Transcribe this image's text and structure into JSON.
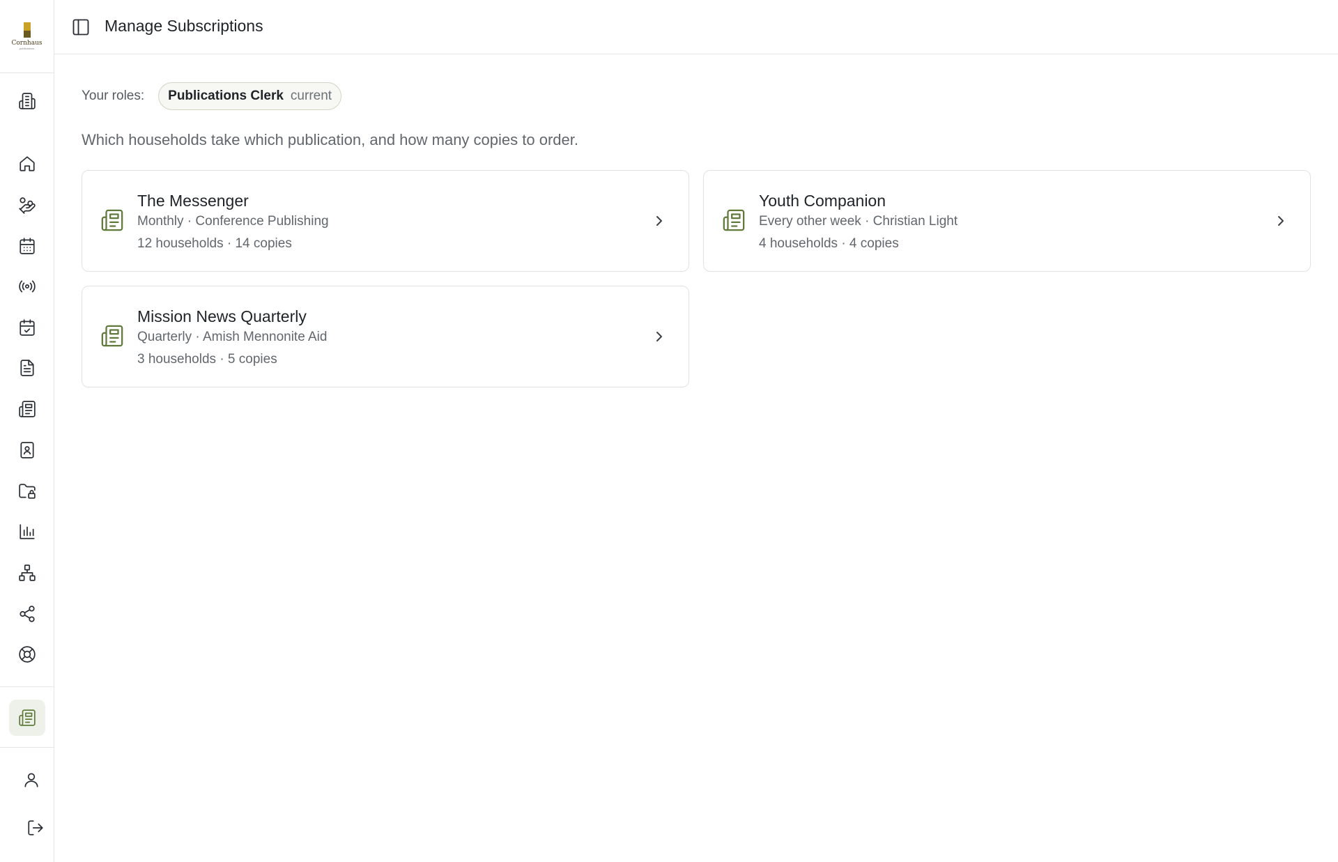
{
  "app": {
    "logo_text": "Cornhaus",
    "logo_subtext": "publications"
  },
  "header": {
    "title": "Manage Subscriptions"
  },
  "sidebar": {
    "items": [
      {
        "icon": "building-icon"
      },
      {
        "icon": "home-icon"
      },
      {
        "icon": "hand-coins-icon"
      },
      {
        "icon": "calendar-icon"
      },
      {
        "icon": "broadcast-icon"
      },
      {
        "icon": "calendar-check-icon"
      },
      {
        "icon": "document-icon"
      },
      {
        "icon": "newspaper-icon"
      },
      {
        "icon": "contact-book-icon"
      },
      {
        "icon": "folder-lock-icon"
      },
      {
        "icon": "bar-chart-icon"
      },
      {
        "icon": "org-chart-icon"
      },
      {
        "icon": "share-icon"
      },
      {
        "icon": "lifebuoy-icon"
      }
    ],
    "active": {
      "icon": "newspaper-icon"
    },
    "bottom": [
      {
        "icon": "user-icon"
      },
      {
        "icon": "logout-icon"
      }
    ]
  },
  "roles": {
    "label": "Your roles:",
    "items": [
      {
        "name": "Publications Clerk",
        "status": "current"
      }
    ]
  },
  "description": "Which households take which publication, and how many copies to order.",
  "publications": [
    {
      "title": "The Messenger",
      "meta": "Monthly · Conference Publishing",
      "counts": "12 households · 14 copies"
    },
    {
      "title": "Youth Companion",
      "meta": "Every other week · Christian Light",
      "counts": "4 households · 4 copies"
    },
    {
      "title": "Mission News Quarterly",
      "meta": "Quarterly · Amish Mennonite Aid",
      "counts": "3 households · 5 copies"
    }
  ],
  "colors": {
    "accent": "#5f7a3a",
    "active_bg": "#eef1ea",
    "border": "#e2e2e2"
  }
}
